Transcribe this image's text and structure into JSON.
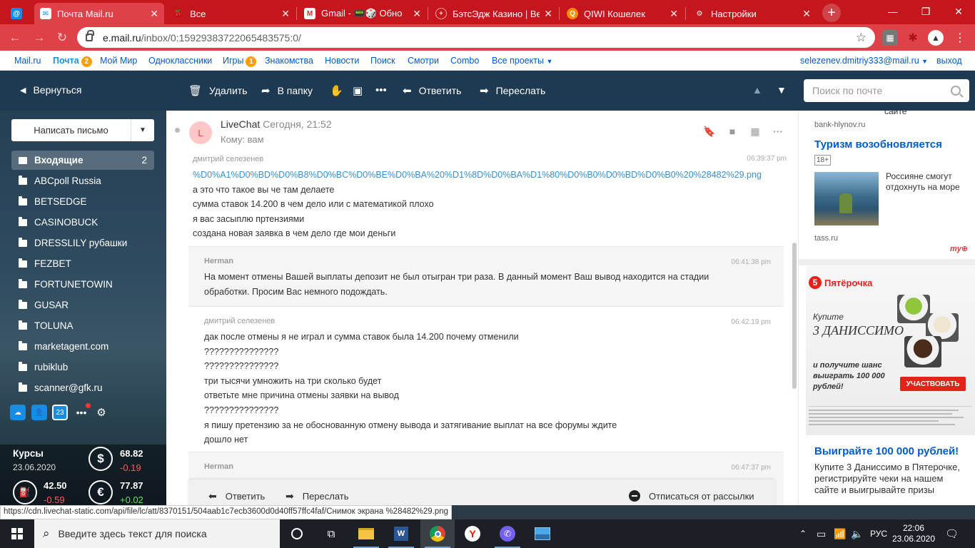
{
  "browser": {
    "tabs": [
      {
        "label": "Почта Mail.ru",
        "icon": "mailru-icon",
        "active": true
      },
      {
        "label": "Все",
        "icon": "cherry-icon",
        "active": false
      },
      {
        "label": "Gmail - 📟🎲 Обно",
        "icon": "gmail-icon",
        "active": false
      },
      {
        "label": "БэтсЭдж Казино | Bets",
        "icon": "betsedge-icon",
        "active": false
      },
      {
        "label": "QIWI Кошелек",
        "icon": "qiwi-icon",
        "active": false
      },
      {
        "label": "Настройки",
        "icon": "gear-icon",
        "active": false
      }
    ],
    "url_host": "e.mail.ru",
    "url_path": "/inbox/0:15929383722065483575:0/"
  },
  "portal": {
    "links": [
      "Mail.ru",
      "Почта",
      "Мой Мир",
      "Одноклассники",
      "Игры",
      "Знакомства",
      "Новости",
      "Поиск",
      "Смотри",
      "Combo",
      "Все проекты"
    ],
    "mail_badge": "2",
    "games_badge": "1",
    "user": "selezenev.dmitriy333@mail.ru",
    "logout": "выход"
  },
  "mailbar": {
    "back": "Вернуться",
    "delete": "Удалить",
    "move": "В папку",
    "reply": "Ответить",
    "forward": "Переслать",
    "search_placeholder": "Поиск по почте"
  },
  "sidebar": {
    "compose": "Написать письмо",
    "folders": [
      {
        "label": "Входящие",
        "count": "2"
      },
      {
        "label": "ABCpoll Russia"
      },
      {
        "label": "BETSEDGE"
      },
      {
        "label": "CASINOBUCK"
      },
      {
        "label": "DRESSLILY рубашки"
      },
      {
        "label": "FEZBET"
      },
      {
        "label": "FORTUNETOWIN"
      },
      {
        "label": "GUSAR"
      },
      {
        "label": "TOLUNA"
      },
      {
        "label": "marketagent.com"
      },
      {
        "label": "rubiklub"
      },
      {
        "label": "scanner@gfk.ru"
      }
    ],
    "rates": {
      "title": "Курсы",
      "date": "23.06.2020",
      "usd": "68.82",
      "usd_change": "-0.19",
      "oil": "42.50",
      "oil_change": "-0.59",
      "eur": "77.87",
      "eur_change": "+0.02"
    }
  },
  "message": {
    "avatar_letter": "L",
    "sender": "LiveChat",
    "date": "Сегодня, 21:52",
    "to": "Кому: вам",
    "chat": [
      {
        "who": "дмитрий селезенев",
        "time": "06:39:37 pm",
        "link": "%D0%A1%D0%BD%D0%B8%D0%BC%D0%BE%D0%BA%20%D1%8D%D0%BA%D1%80%D0%B0%D0%BD%D0%B0%20%28482%29.png",
        "lines": [
          "а это что такое вы че там делаете",
          "сумма ставок 14.200 в чем дело или с математикой плохо",
          "я вас засыплю пртензиями",
          "создана новая заявка в чем дело где мои деньги"
        ]
      },
      {
        "who": "Herman",
        "time": "06:41:38 pm",
        "lines": [
          "На момент отмены Вашей выплаты депозит не был отыгран три раза. В данный момент Ваш вывод находится на стадии",
          "обработки. Просим Вас немного подождать."
        ]
      },
      {
        "who": "дмитрий селезенев",
        "time": "06:42:19 pm",
        "lines": [
          "дак после отмены я не играл и сумма ставок была 14.200 почему отменили",
          "???????????????",
          "???????????????",
          "три тысячи умножить на три сколько будет",
          "ответьте мне причина отмены заявки на вывод",
          "???????????????",
          "я пишу претензию за не обоснованную отмену вывода и затягивание выплат на все форумы ждите",
          "дошло нет"
        ]
      },
      {
        "who": "Herman",
        "time": "06:47:37 pm",
        "lines": []
      }
    ],
    "bottom": {
      "reply": "Ответить",
      "forward": "Переслать",
      "unsubscribe": "Отписаться от рассылки"
    }
  },
  "ads": {
    "top_cut": "сайте",
    "source1": "bank-hlynov.ru",
    "headline1": "Туризм возобновляется",
    "age": "18+",
    "teaser1": "Россияне смогут отдохнуть на море",
    "source2": "tass.ru",
    "brand": "Пятёрочка",
    "promo_buy": "Купите",
    "promo_product": "3 ДАНИССИМО",
    "promo_get": "и получите шанс выиграть 100 000 рублей!",
    "promo_button": "УЧАСТВОВАТЬ",
    "headline2": "Выиграйте 100 000 рублей!",
    "teaser2": "Купите 3 Даниссимо в Пятерочке, регистрируйте чеки на нашем сайте и выигрывайте призы",
    "mytarget": "my"
  },
  "status_url": "https://cdn.livechat-static.com/api/file/lc/att/8370151/504aab1c7ecb3600d0d40ff57ffc4faf/Снимок экрана %28482%29.png",
  "taskbar": {
    "search_placeholder": "Введите здесь текст для поиска",
    "lang": "РУС",
    "time": "22:06",
    "date": "23.06.2020"
  },
  "colors": {
    "browser_red": "#c4161c",
    "mail_dark": "#1e3a52",
    "link_blue": "#005bd1",
    "accent_orange": "#ff9e00"
  }
}
